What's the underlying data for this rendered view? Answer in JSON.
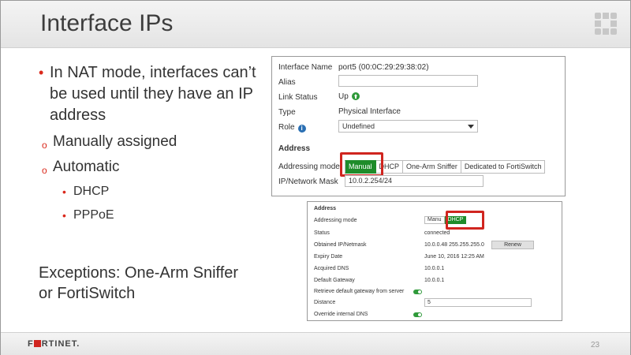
{
  "slide": {
    "title": "Interface IPs",
    "page_number": "23",
    "footer_logo": "F■RTINET."
  },
  "bullets": {
    "main": "In NAT mode, interfaces can’t be used until they have an IP address",
    "sub": [
      {
        "label": "Manually assigned"
      },
      {
        "label": "Automatic"
      }
    ],
    "automatic_items": [
      "DHCP",
      "PPPoE"
    ],
    "exceptions": "Exceptions: One-Arm Sniffer or FortiSwitch"
  },
  "panel1": {
    "interface_name_label": "Interface Name",
    "interface_name_value": "port5 (00:0C:29:29:38:02)",
    "alias_label": "Alias",
    "alias_value": "",
    "link_status_label": "Link Status",
    "link_status_value": "Up",
    "type_label": "Type",
    "type_value": "Physical Interface",
    "role_label": "Role",
    "role_value": "Undefined",
    "address_heading": "Address",
    "addressing_mode_label": "Addressing mode",
    "modes": [
      "Manual",
      "DHCP",
      "One-Arm Sniffer",
      "Dedicated to FortiSwitch"
    ],
    "active_mode": "Manual",
    "ip_mask_label": "IP/Network Mask",
    "ip_mask_value": "10.0.2.254/24",
    "accent_color": "#1e8c2a",
    "highlight_color": "#d0251f"
  },
  "panel2": {
    "address_heading": "Address",
    "addressing_mode_label": "Addressing mode",
    "modes": [
      "Manu",
      "DHCP"
    ],
    "active_mode": "DHCP",
    "status_label": "Status",
    "status_value": "connected",
    "obtained_label": "Obtained IP/Netmask",
    "obtained_value": "10.0.0.48 255.255.255.0",
    "renew_label": "Renew",
    "expiry_label": "Expiry Date",
    "expiry_value": "June 10, 2016 12:25 AM",
    "dns_label": "Acquired DNS",
    "dns_value": "10.0.0.1",
    "gateway_label": "Default Gateway",
    "gateway_value": "10.0.0.1",
    "retrieve_label": "Retrieve default gateway from server",
    "retrieve_on": true,
    "distance_label": "Distance",
    "distance_value": "5",
    "override_label": "Override internal DNS",
    "override_on": true
  }
}
